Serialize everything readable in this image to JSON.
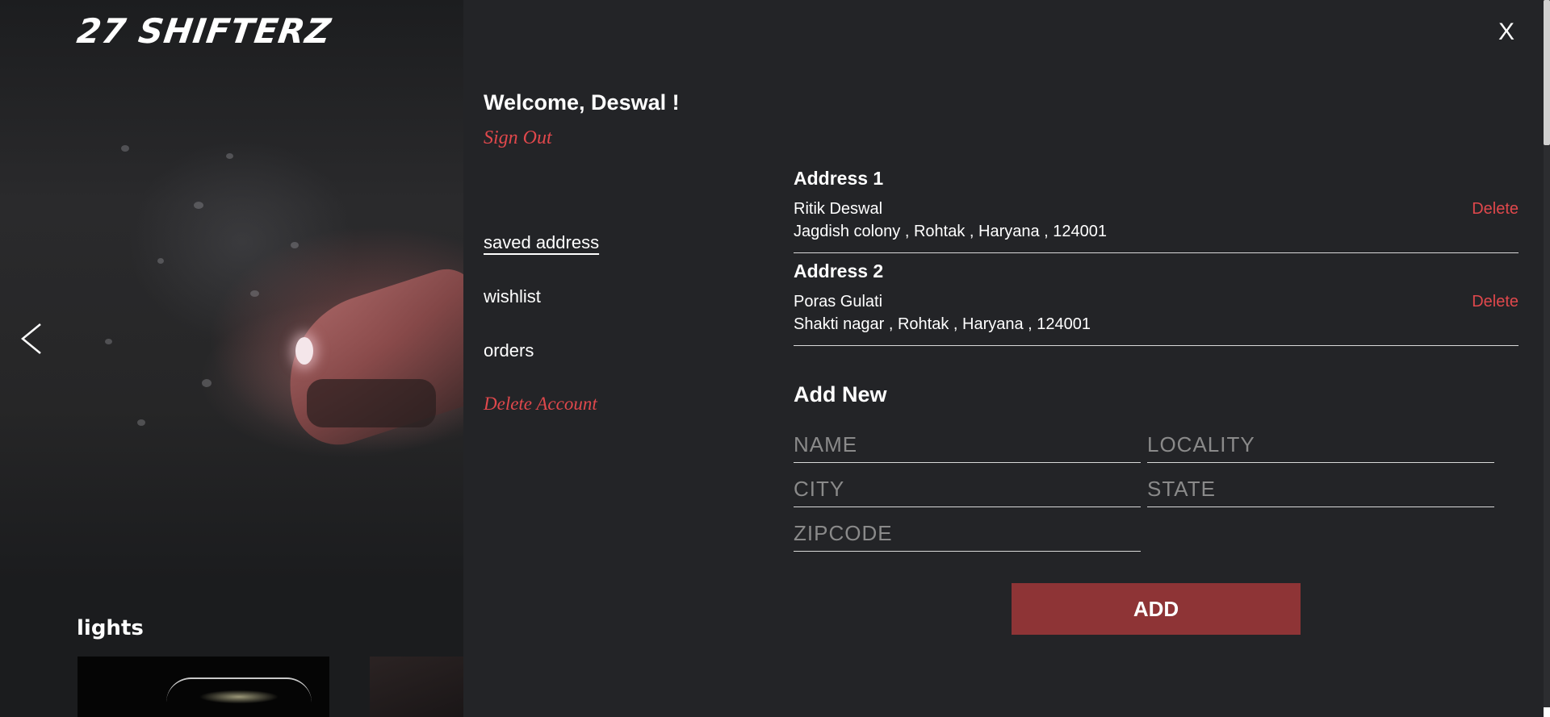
{
  "brand": {
    "logo_text": "27 SHIFTERZ"
  },
  "background": {
    "section_title": "lights",
    "prev_icon": "chevron-left-icon"
  },
  "account": {
    "close_label": "X",
    "welcome": "Welcome, Deswal !",
    "sign_out": "Sign Out",
    "nav": {
      "saved_address": "saved address",
      "wishlist": "wishlist",
      "orders": "orders",
      "delete_account": "Delete Account"
    },
    "addresses": [
      {
        "title": "Address 1",
        "name": "Ritik Deswal",
        "line": "Jagdish colony , Rohtak , Haryana , 124001",
        "delete_label": "Delete"
      },
      {
        "title": "Address 2",
        "name": "Poras Gulati",
        "line": "Shakti nagar , Rohtak , Haryana , 124001",
        "delete_label": "Delete"
      }
    ],
    "add_new": {
      "title": "Add New",
      "placeholders": {
        "name": "NAME",
        "locality": "LOCALITY",
        "city": "CITY",
        "state": "STATE",
        "zipcode": "ZIPCODE"
      },
      "button_label": "ADD"
    }
  },
  "colors": {
    "panel_bg": "#232427",
    "accent_red": "#e0484c",
    "button_red": "#8e3436"
  }
}
